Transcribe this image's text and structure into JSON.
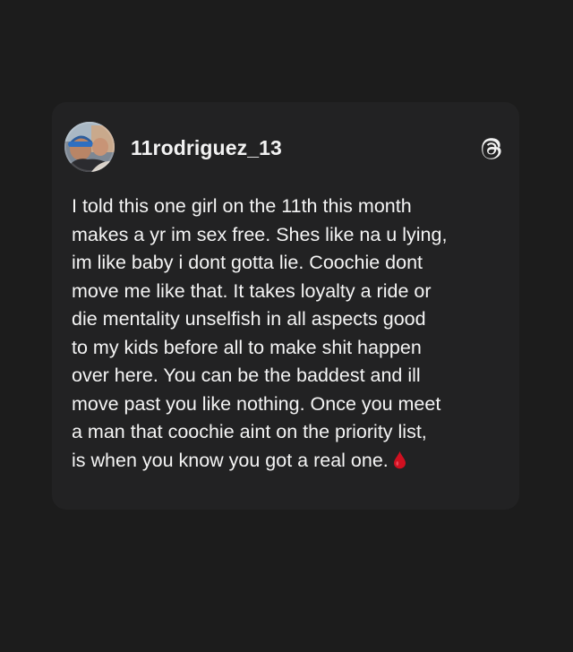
{
  "post": {
    "username": "11rodriguez_13",
    "avatar_icon": "profile-photo",
    "app_icon": "threads-logo-icon",
    "lines": [
      "I told this one girl on the 11th this month",
      "makes a yr im sex free. Shes like na u lying,",
      "im like baby i dont gotta lie. Coochie dont",
      "move me like that. It takes loyalty a ride or",
      "die mentality unselfish in all aspects good",
      "to my kids before all to make shit happen",
      "over here. You can be the baddest and ill",
      "move past you like nothing. Once you meet",
      "a man that coochie aint on the priority list,",
      "is when you know you got a real one."
    ],
    "trailing_emoji": "blood-drop-icon"
  },
  "colors": {
    "background": "#1c1c1c",
    "card": "#222223",
    "text": "#f4f4f4",
    "emoji": "#d01020"
  }
}
